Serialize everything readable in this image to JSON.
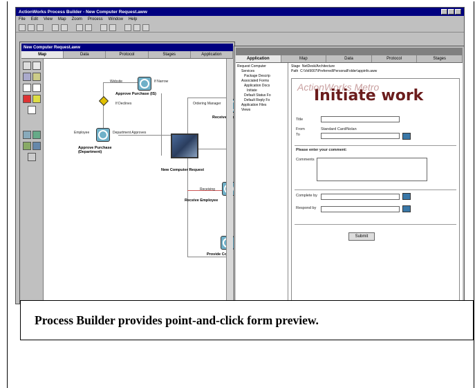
{
  "app": {
    "title": "ActionWorks Process Builder - New Computer Request.aww",
    "menu": [
      "File",
      "Edit",
      "View",
      "Map",
      "Zoom",
      "Process",
      "Window",
      "Help"
    ]
  },
  "map_window": {
    "title": "New Computer Request.aww",
    "tabs": [
      "Map",
      "Data",
      "Protocol",
      "Stages",
      "Application"
    ],
    "nodes": {
      "approve_purchase": "Approve Purchase (IS)",
      "approve_dept": "Approve Purchase (Department)",
      "new_computer_request": "New Computer Request",
      "receive_req": "Receive Req",
      "receive_employee": "Receive Employee",
      "provide": "Provide Com"
    },
    "links": {
      "website": "Website",
      "if_narrow": "If Narrow",
      "if_declines": "If Declines",
      "employee": "Employee",
      "department_approves": "Department Approves",
      "ordering_manager": "Ordering Manager",
      "receiving": "Receiving"
    }
  },
  "app_window": {
    "tabs": [
      "Application",
      "Map",
      "Data",
      "Protocol",
      "Stages"
    ],
    "tree": [
      "Request Computer",
      "Services",
      "Package Descrip",
      "Associated Forms",
      "Application Docs",
      "Initiate",
      "Default Status Fo",
      "Default Reply Fo",
      "Application Files",
      "Views"
    ],
    "stage_label": "Stage",
    "stage_value": "NetDesk/Architecture",
    "path_label": "Path",
    "path_value": "C:\\Vol9007\\Preferred\\PersonalFolder\\appinfo.aww",
    "form": {
      "banner_small": "ActionWorks Metro",
      "banner_big": "Initiate work",
      "title_label": "Title",
      "from_label": "From",
      "from_value": "Standard Card/Nolan",
      "to_label": "To",
      "comment_prompt": "Please enter your comment:",
      "comments_label": "Comments",
      "complete_by_label": "Complete by",
      "respond_by_label": "Respond by",
      "submit_label": "Submit"
    }
  },
  "caption": "Process Builder provides point-and-click form preview."
}
